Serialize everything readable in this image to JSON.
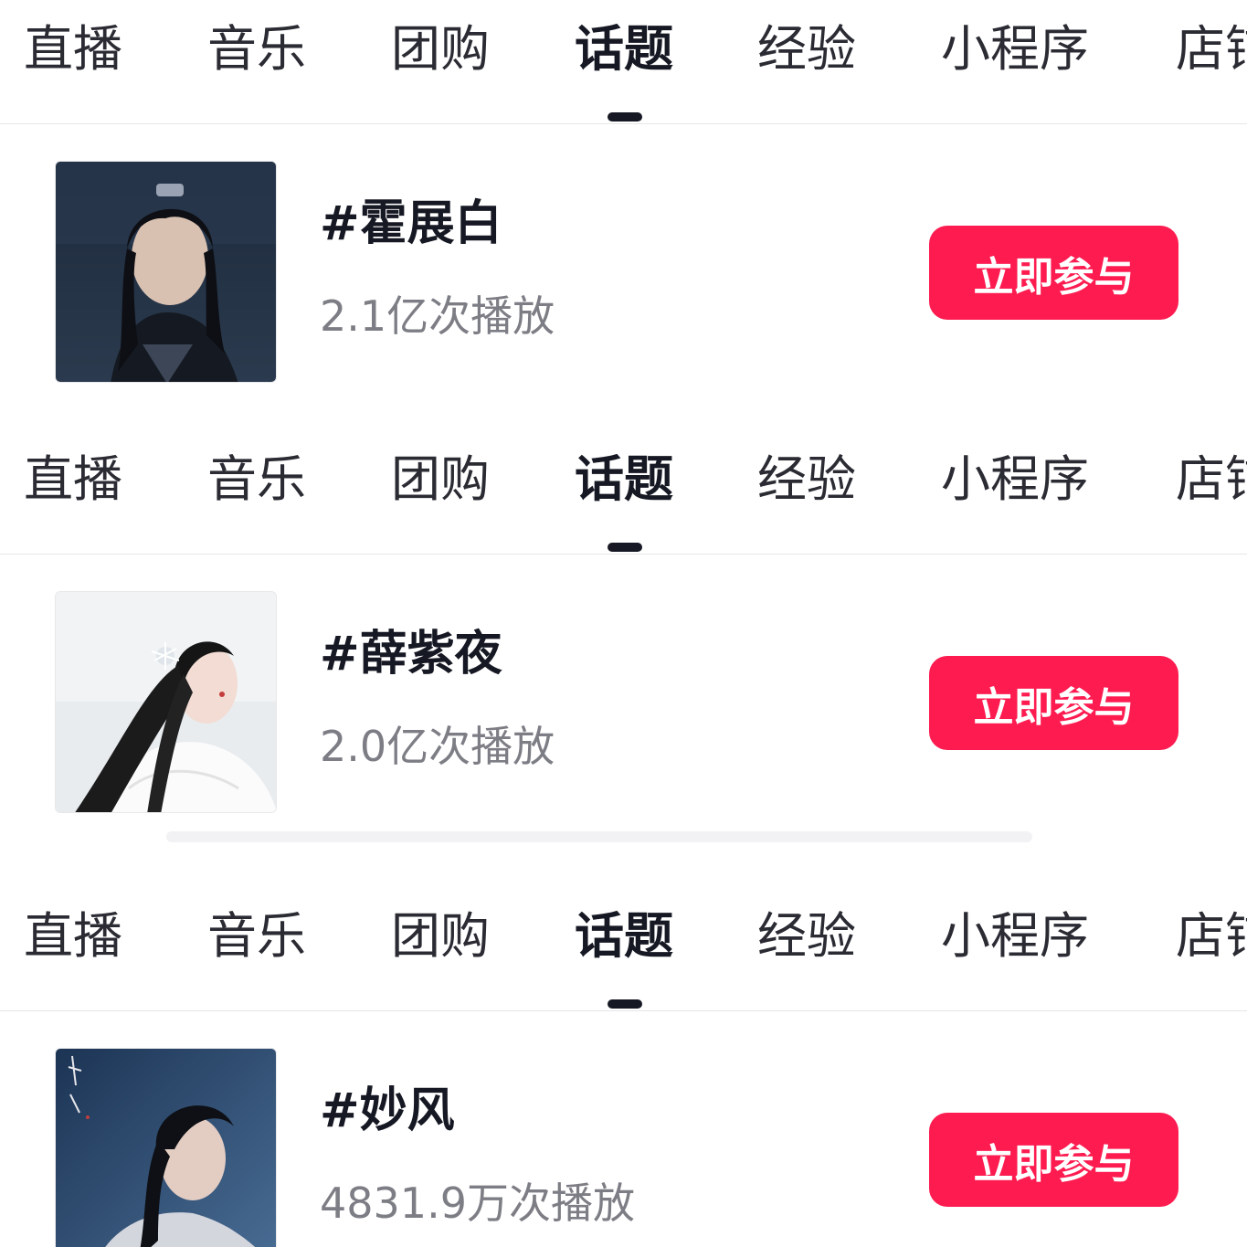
{
  "tabs": {
    "labels": [
      "直播",
      "音乐",
      "团购",
      "话题",
      "经验",
      "小程序",
      "店铺"
    ],
    "active_index": 3
  },
  "colors": {
    "accent": "#fe1b50",
    "text_primary": "#161823",
    "text_secondary": "#7d7e85",
    "indicator": "#161823"
  },
  "topics": [
    {
      "title": "#霍展白",
      "plays": "2.1亿次播放",
      "button": "立即参与",
      "thumb_icon": "portrait-man-dark-icon"
    },
    {
      "title": "#薛紫夜",
      "plays": "2.0亿次播放",
      "button": "立即参与",
      "thumb_icon": "portrait-woman-white-fur-icon"
    },
    {
      "title": "#妙风",
      "plays": "4831.9万次播放",
      "button": "立即参与",
      "thumb_icon": "portrait-man-blue-night-icon"
    }
  ]
}
